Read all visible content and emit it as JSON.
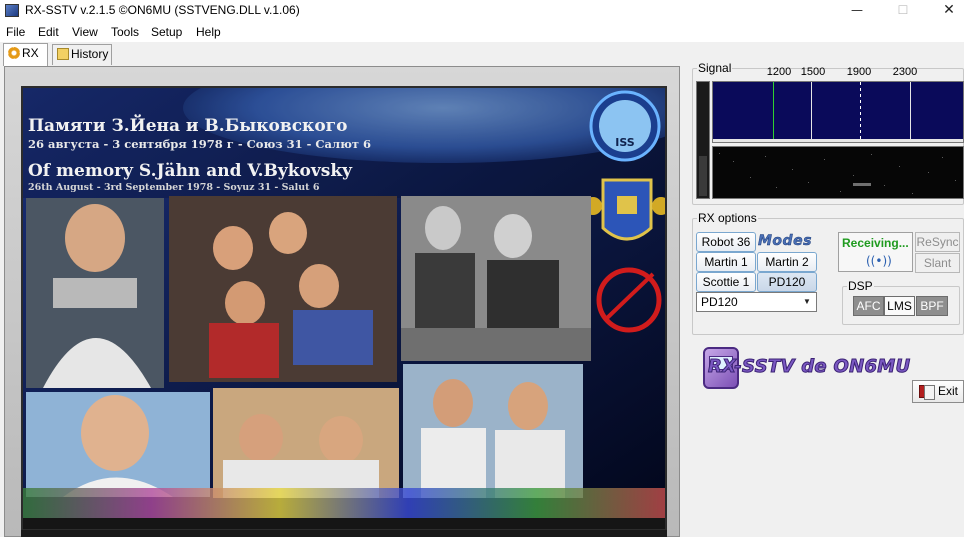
{
  "window": {
    "title": "RX-SSTV v.2.1.5 ©ON6MU (SSTVENG.DLL v.1.06)",
    "minimize_glyph": "—",
    "maximize_glyph": "☐",
    "close_glyph": "✕"
  },
  "menu": [
    "File",
    "Edit",
    "View",
    "Tools",
    "Setup",
    "Help"
  ],
  "tabs": [
    {
      "label": "RX",
      "icon": "gear-icon",
      "active": true
    },
    {
      "label": "History",
      "icon": "history-folder-icon",
      "active": false
    }
  ],
  "received_image": {
    "title_ru": "Памяти З.Йена и В.Быковского",
    "subtitle_ru": "26 августа - 3 сентября 1978 г - Союз 31 - Салют 6",
    "title_en": "Of memory S.Jähn and V.Bykovsky",
    "subtitle_en": "26th August - 3rd September 1978 - Soyuz 31 - Salut 6",
    "badge_text": "ISS"
  },
  "signal": {
    "label": "Signal",
    "freq_labels": [
      "1200",
      "1500",
      "1900",
      "2300"
    ],
    "marker_color_sync": "#2fd12f",
    "marker_color_data": "#ffffff",
    "spectrum_bg": "#0a0a5a"
  },
  "rx_options": {
    "label": "RX options",
    "modes_logo": "Modes",
    "mode_buttons": {
      "robot36": "Robot 36",
      "martin1": "Martin 1",
      "martin2": "Martin 2",
      "scottie1": "Scottie 1",
      "pd120": "PD120"
    },
    "selected_mode": "PD120",
    "status": "Receiving...",
    "status_color": "#1f9b1f",
    "resync": "ReSync",
    "slant": "Slant",
    "dsp": {
      "label": "DSP",
      "afc": "AFC",
      "lms": "LMS",
      "bpf": "BPF"
    }
  },
  "logo_text": "RX-SSTV de ON6MU",
  "exit_label": "Exit"
}
